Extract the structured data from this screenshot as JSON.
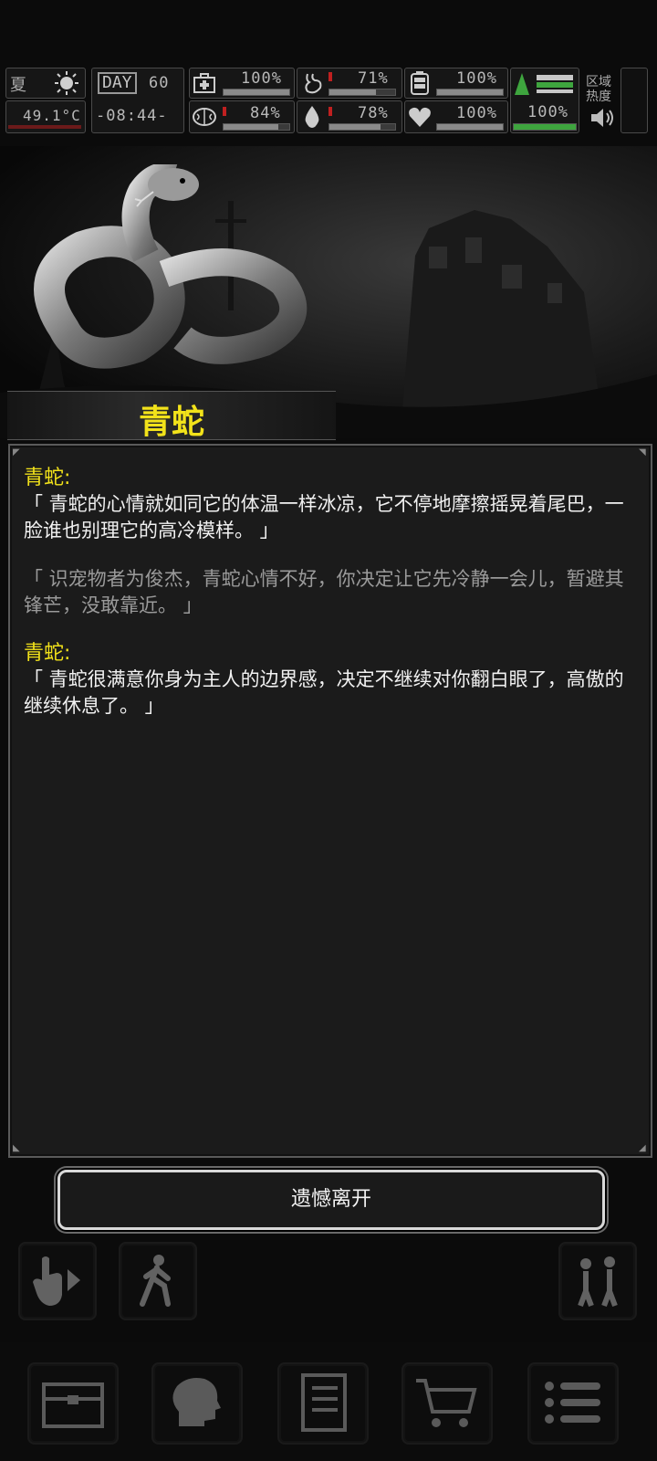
{
  "hud": {
    "season": "夏",
    "temperature": "49.1°C",
    "day_label": "DAY",
    "day_number": "60",
    "time": "-08:44-",
    "stats": {
      "health": {
        "icon": "medkit-icon",
        "value": "100%",
        "level": 1.0
      },
      "stomach": {
        "icon": "stomach-icon",
        "value": "71%",
        "level": 0.71
      },
      "stamina": {
        "icon": "battery-icon",
        "value": "100%",
        "level": 1.0
      },
      "mind": {
        "icon": "brain-icon",
        "value": "84%",
        "level": 0.84
      },
      "water": {
        "icon": "water-drop-icon",
        "value": "78%",
        "level": 0.78
      },
      "heart": {
        "icon": "heart-icon",
        "value": "100%",
        "level": 1.0
      },
      "bag": {
        "icon": "flag-icon",
        "value": "100%",
        "level": 1.0
      }
    },
    "area_label": "区域热度"
  },
  "scene": {
    "creature_name": "青蛇"
  },
  "dialog": {
    "entries": [
      {
        "speaker": "青蛇:",
        "text": "「 青蛇的心情就如同它的体温一样冰凉，它不停地摩擦摇晃着尾巴，一脸谁也别理它的高冷模样。 」",
        "style": "white"
      },
      {
        "speaker": "",
        "text": "「 识宠物者为俊杰，青蛇心情不好，你决定让它先冷静一会儿，暂避其锋芒，没敢靠近。 」",
        "style": "gray"
      },
      {
        "speaker": "青蛇:",
        "text": "「 青蛇很满意你身为主人的边界感，决定不继续对你翻白眼了，高傲的继续休息了。 」",
        "style": "white"
      }
    ]
  },
  "leave_button": "遗憾离开",
  "colors": {
    "accent_yellow": "#f2e21a",
    "bar_green": "#3ea53e"
  }
}
